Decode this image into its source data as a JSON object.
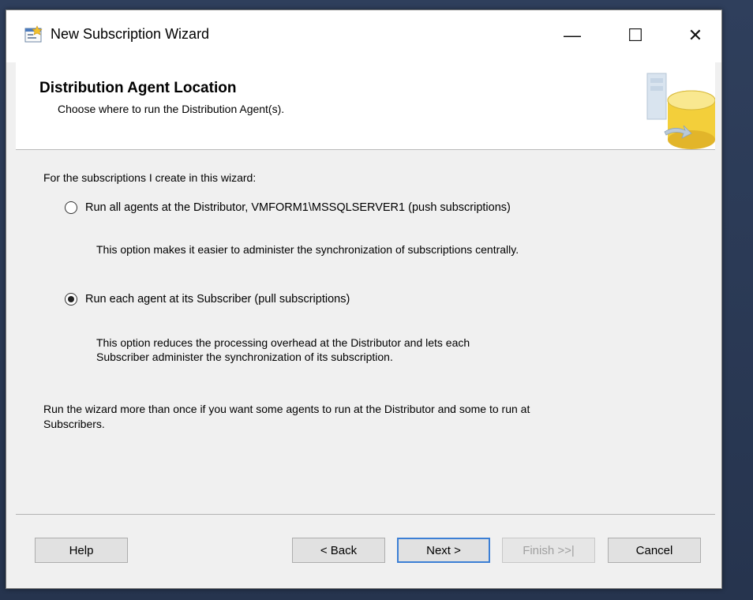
{
  "window": {
    "title": "New Subscription Wizard",
    "controls": {
      "minimize": "—",
      "maximize": "☐",
      "close": "✕"
    }
  },
  "header": {
    "title": "Distribution Agent Location",
    "subtitle": "Choose where to run the Distribution Agent(s)."
  },
  "body": {
    "intro": "For the subscriptions I create in this wizard:",
    "options": [
      {
        "label": "Run all agents at the Distributor, VMFORM1\\MSSQLSERVER1 (push subscriptions)",
        "checked": false,
        "description_lines": [
          "This option makes it easier to administer the synchronization of subscriptions centrally."
        ]
      },
      {
        "label": "Run each agent at its Subscriber (pull subscriptions)",
        "checked": true,
        "description_lines": [
          "This option reduces the processing overhead at the Distributor and lets each",
          "Subscriber administer the synchronization of its subscription."
        ]
      }
    ],
    "footnote_lines": [
      "Run the wizard more than once if you want some agents to run at the Distributor and some to run at",
      "Subscribers."
    ]
  },
  "buttons": {
    "help": "Help",
    "back": "< Back",
    "next": "Next >",
    "finish": "Finish >>|",
    "cancel": "Cancel"
  },
  "icons": {
    "app": "wizard-app-icon",
    "header": "database-server-icon"
  },
  "colors": {
    "accent_focus": "#3c7fd5",
    "dialog_bg": "#f0f0f0",
    "header_bg": "#ffffff"
  }
}
